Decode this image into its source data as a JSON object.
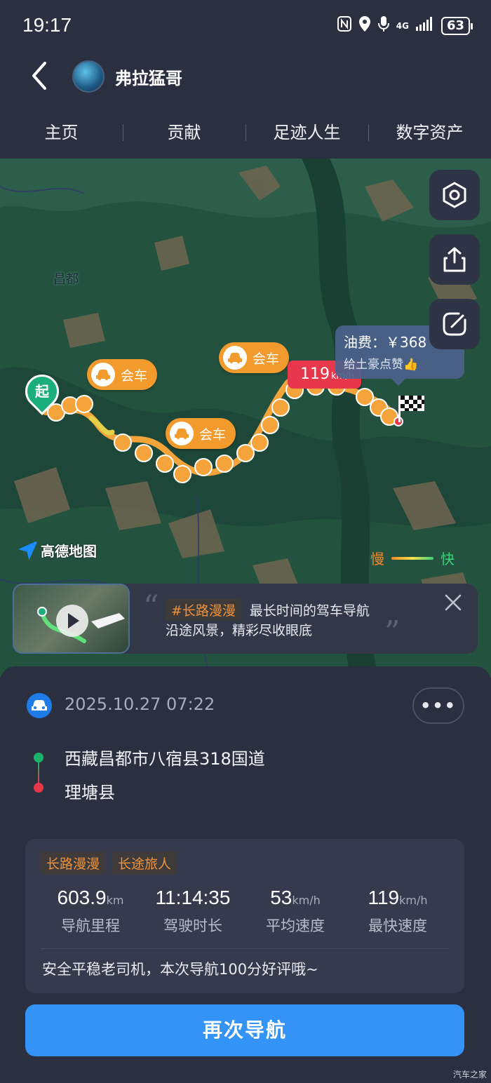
{
  "status_bar": {
    "time": "19:17",
    "network": "4G",
    "battery": "63"
  },
  "header": {
    "username": "弗拉猛哥"
  },
  "tabs": [
    {
      "label": "主页"
    },
    {
      "label": "贡献"
    },
    {
      "label": "足迹人生"
    },
    {
      "label": "数字资产"
    }
  ],
  "map": {
    "city_label": "昌都",
    "start_label": "起",
    "meet_label": "会车",
    "max_speed_value": "119",
    "max_speed_unit": "km/h",
    "fee_text": "油费：￥368",
    "fee_sub": "给土豪点赞👍",
    "logo_text": "高德地图",
    "legend_slow": "慢",
    "legend_fast": "快"
  },
  "promo": {
    "tag": "#长路漫漫",
    "headline": "最长时间的驾车导航",
    "subline": "沿途风景，精彩尽收眼底"
  },
  "trip": {
    "datetime": "2025.10.27 07:22",
    "more_label": "•••",
    "from": "西藏昌都市八宿县318国道",
    "to": "理塘县"
  },
  "stats": {
    "badges": [
      "长路漫漫",
      "长途旅人"
    ],
    "items": [
      {
        "value": "603.9",
        "unit": "km",
        "label": "导航里程"
      },
      {
        "value": "11:14:35",
        "unit": "",
        "label": "驾驶时长"
      },
      {
        "value": "53",
        "unit": "km/h",
        "label": "平均速度"
      },
      {
        "value": "119",
        "unit": "km/h",
        "label": "最快速度"
      }
    ],
    "comment": "安全平稳老司机，本次导航100分好评哦~"
  },
  "nav_button": "再次导航",
  "watermark": "汽车之家",
  "colors": {
    "accent": "#3393f7",
    "route": "#f39a2c",
    "speed_tag": "#e8364a",
    "start": "#1aae7d"
  }
}
